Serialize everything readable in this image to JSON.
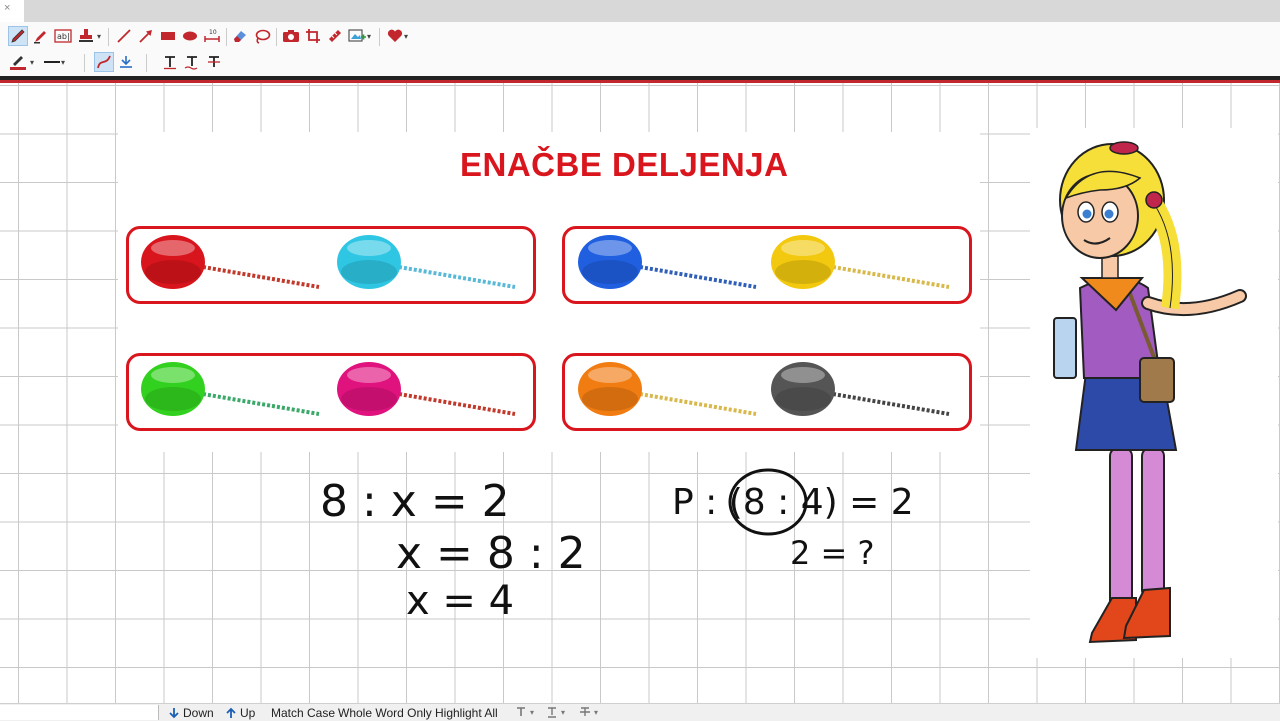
{
  "titlebar": {
    "close_glyph": "×"
  },
  "toolbar": {
    "row1_icons": [
      "pen-icon",
      "highlighter-icon",
      "text-box-icon",
      "stamp-icon",
      "line-icon",
      "arrow-icon",
      "rectangle-icon",
      "ellipse-icon",
      "measure-icon",
      "eraser-icon",
      "lasso-icon",
      "screenshot-icon",
      "crop-icon",
      "ruler-icon",
      "insert-image-icon",
      "favorites-heart-icon"
    ],
    "row2_icons": [
      "pen-color-icon",
      "line-style-icon",
      "smooth-curve-icon",
      "snap-icon",
      "text-icon",
      "text-baseline-icon",
      "text-strike-icon"
    ],
    "measure_label": "10"
  },
  "slide": {
    "title": "ENAČBE DELJENJA",
    "lollipop_rows": [
      [
        {
          "color": "red",
          "hex": "#d8141c",
          "stick": "#c0392b"
        },
        {
          "color": "cyan",
          "hex": "#2fc6e4",
          "stick": "#58b8d8"
        },
        {
          "color": "blue",
          "hex": "#1f5fe0",
          "stick": "#2f5fb8"
        },
        {
          "color": "yellow",
          "hex": "#f2c90f",
          "stick": "#d8b84a"
        }
      ],
      [
        {
          "color": "green",
          "hex": "#33d11f",
          "stick": "#3aa868"
        },
        {
          "color": "magenta",
          "hex": "#e0127e",
          "stick": "#c0392b"
        },
        {
          "color": "orange",
          "hex": "#f07c12",
          "stick": "#d8b84a"
        },
        {
          "color": "gray",
          "hex": "#555555",
          "stick": "#444444"
        }
      ]
    ]
  },
  "handwriting": {
    "left": [
      "8 : x = 2",
      "x = 8 : 2",
      "x = 4"
    ],
    "right": [
      "P : (8 : 4) = 2",
      "2 = ?"
    ]
  },
  "colors": {
    "accent": "#d9161d",
    "toolbar_red": "#c1272d"
  },
  "findbar": {
    "down_label": "Down",
    "up_label": "Up",
    "match_case_label": "Match Case",
    "whole_word_label": "Whole Word Only",
    "highlight_all_label": "Highlight All"
  }
}
